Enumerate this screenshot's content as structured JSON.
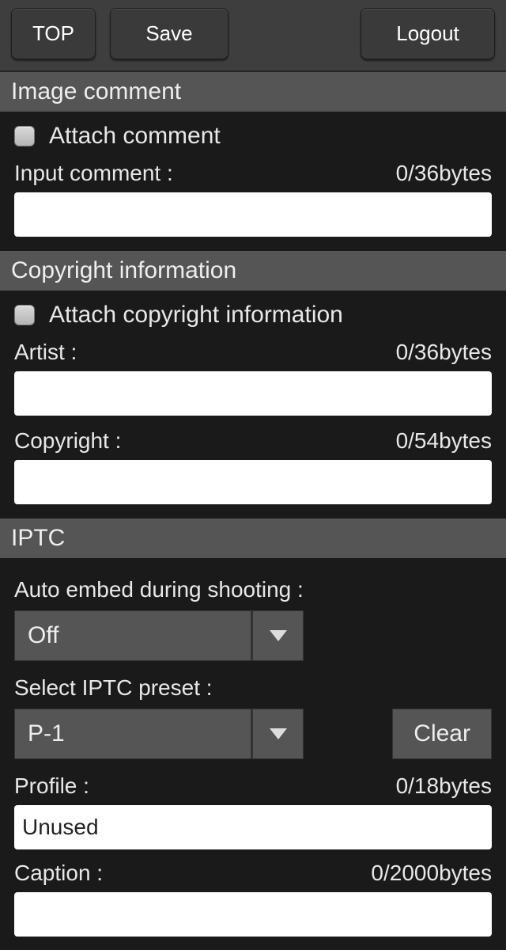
{
  "toolbar": {
    "top": "TOP",
    "save": "Save",
    "logout": "Logout"
  },
  "sections": {
    "image_comment": {
      "title": "Image comment",
      "attach_label": "Attach comment",
      "input_label": "Input comment :",
      "input_counter": "0/36bytes",
      "input_value": ""
    },
    "copyright": {
      "title": "Copyright information",
      "attach_label": "Attach copyright information",
      "artist_label": "Artist :",
      "artist_counter": "0/36bytes",
      "artist_value": "",
      "copyright_label": "Copyright :",
      "copyright_counter": "0/54bytes",
      "copyright_value": ""
    },
    "iptc": {
      "title": "IPTC",
      "auto_embed_label": "Auto embed during shooting :",
      "auto_embed_value": "Off",
      "select_preset_label": "Select IPTC preset :",
      "select_preset_value": "P-1",
      "clear_label": "Clear",
      "profile_label": "Profile :",
      "profile_counter": "0/18bytes",
      "profile_value": "Unused",
      "caption_label": "Caption :",
      "caption_counter": "0/2000bytes",
      "caption_value": ""
    }
  }
}
